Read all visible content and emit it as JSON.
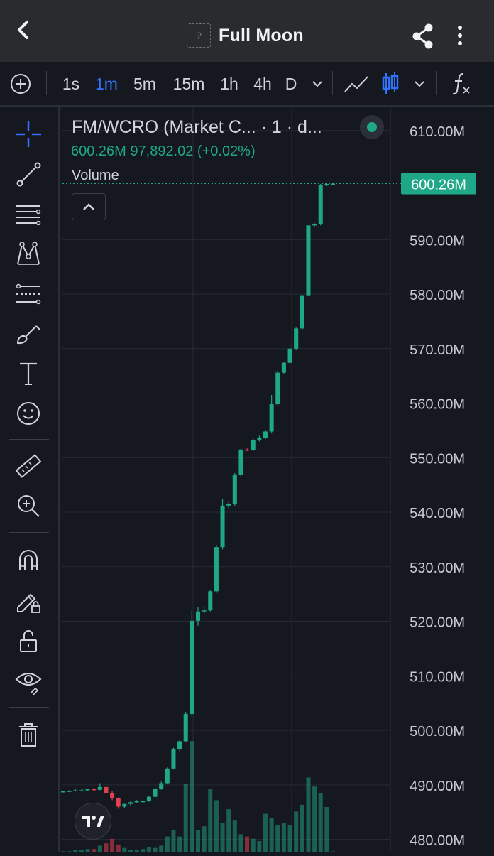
{
  "header": {
    "title": "Full Moon",
    "token_placeholder": "?"
  },
  "toolbar": {
    "intervals": [
      "1s",
      "1m",
      "5m",
      "15m",
      "1h",
      "4h",
      "D"
    ],
    "active_interval": "1m"
  },
  "legend": {
    "symbol_line": "FM/WCRO (Market C...  · 1 · d...",
    "value_line": "600.26M  97,892.02 (+0.02%)",
    "volume_label": "Volume"
  },
  "price_badge": "600.26M",
  "colors": {
    "up": "#1fa887",
    "down": "#e2404f",
    "background": "#15181f",
    "accent": "#2f73ff"
  },
  "chart_data": {
    "type": "candlestick",
    "yaxis_labels": [
      "610.00M",
      "600.00M",
      "590.00M",
      "580.00M",
      "570.00M",
      "560.00M",
      "550.00M",
      "540.00M",
      "530.00M",
      "520.00M",
      "510.00M",
      "500.00M",
      "490.00M",
      "480.00M"
    ],
    "yaxis_ticks": [
      610,
      600,
      590,
      580,
      570,
      560,
      550,
      540,
      530,
      520,
      510,
      500,
      490,
      480
    ],
    "ylim": [
      477.6,
      614.4
    ],
    "last_price": 600.26,
    "candles": [
      [
        488.8,
        488.9,
        488.7,
        488.8
      ],
      [
        488.8,
        489.0,
        488.7,
        488.9
      ],
      [
        488.9,
        489.2,
        488.8,
        489.0
      ],
      [
        489.0,
        489.2,
        488.8,
        489.0
      ],
      [
        489.0,
        489.3,
        488.9,
        489.2
      ],
      [
        489.2,
        489.4,
        489.0,
        489.1
      ],
      [
        489.1,
        490.3,
        489.0,
        489.6
      ],
      [
        489.6,
        489.8,
        488.5,
        488.5
      ],
      [
        488.5,
        488.8,
        487.2,
        487.5
      ],
      [
        487.5,
        487.7,
        485.6,
        486.0
      ],
      [
        486.0,
        486.5,
        485.7,
        486.5
      ],
      [
        486.5,
        487.0,
        486.2,
        486.8
      ],
      [
        486.8,
        487.2,
        486.6,
        487.0
      ],
      [
        487.0,
        487.2,
        486.9,
        487.0
      ],
      [
        487.0,
        487.9,
        486.9,
        487.8
      ],
      [
        487.8,
        489.5,
        487.7,
        489.3
      ],
      [
        489.3,
        490.6,
        489.1,
        490.3
      ],
      [
        490.3,
        493.2,
        490.1,
        493.0
      ],
      [
        493.0,
        496.8,
        492.8,
        496.6
      ],
      [
        496.6,
        498.2,
        496.2,
        498.0
      ],
      [
        498.0,
        503.4,
        497.8,
        503.0
      ],
      [
        503.0,
        522.2,
        502.6,
        520.1
      ],
      [
        520.1,
        522.6,
        519.2,
        521.8
      ],
      [
        521.8,
        522.8,
        521.4,
        522.0
      ],
      [
        522.0,
        525.8,
        521.8,
        525.5
      ],
      [
        525.5,
        534.0,
        525.2,
        533.6
      ],
      [
        533.6,
        542.4,
        533.2,
        541.2
      ],
      [
        541.2,
        542.0,
        540.7,
        541.5
      ],
      [
        541.5,
        547.2,
        541.2,
        546.8
      ],
      [
        546.8,
        551.8,
        546.5,
        551.5
      ],
      [
        551.5,
        551.7,
        551.2,
        551.4
      ],
      [
        551.4,
        553.5,
        551.2,
        553.3
      ],
      [
        553.3,
        554.0,
        553.0,
        553.6
      ],
      [
        553.6,
        555.0,
        553.4,
        554.8
      ],
      [
        554.8,
        561.5,
        554.6,
        559.8
      ],
      [
        559.8,
        566.0,
        559.6,
        565.6
      ],
      [
        565.6,
        567.6,
        565.4,
        567.4
      ],
      [
        567.4,
        570.6,
        567.2,
        570.0
      ],
      [
        570.0,
        574.0,
        569.8,
        573.7
      ],
      [
        573.7,
        576.8,
        573.5,
        579.8
      ],
      [
        579.8,
        580.6,
        579.6,
        592.6
      ],
      [
        592.6,
        593.0,
        592.4,
        592.8
      ],
      [
        592.8,
        600.2,
        592.6,
        600.0
      ],
      [
        600.0,
        600.4,
        599.8,
        600.2
      ],
      [
        600.2,
        600.4,
        600.1,
        600.26
      ]
    ],
    "volume_max": 100,
    "volumes": [
      1,
      1,
      2,
      2,
      3,
      3,
      6,
      8,
      12,
      7,
      4,
      2,
      2,
      3,
      5,
      4,
      6,
      14,
      20,
      14,
      60,
      98,
      20,
      23,
      56,
      46,
      26,
      38,
      28,
      16,
      14,
      12,
      10,
      34,
      30,
      24,
      26,
      24,
      36,
      42,
      66,
      58,
      52,
      40,
      1
    ]
  }
}
